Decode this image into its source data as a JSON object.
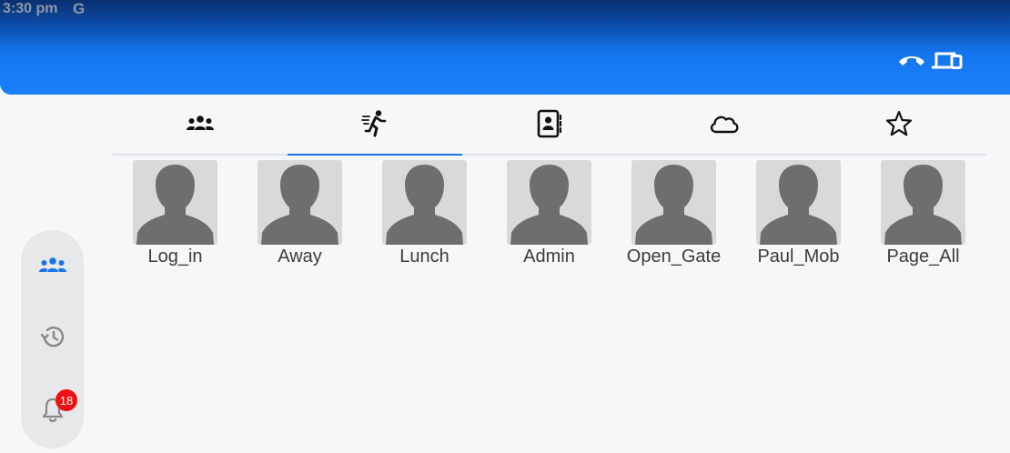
{
  "status_bar": {
    "time": "3:30 pm",
    "g_mark": "G"
  },
  "header": {
    "icons": [
      "call-end-icon",
      "devices-icon"
    ],
    "color": "#1b80fb"
  },
  "tabs": [
    {
      "icon": "group-icon",
      "active": false
    },
    {
      "icon": "running-person-icon",
      "active": true
    },
    {
      "icon": "contacts-book-icon",
      "active": false
    },
    {
      "icon": "cloud-icon",
      "active": false
    },
    {
      "icon": "star-icon",
      "active": false
    }
  ],
  "contacts": [
    {
      "name": "Log_in"
    },
    {
      "name": "Away"
    },
    {
      "name": "Lunch"
    },
    {
      "name": "Admin"
    },
    {
      "name": "Open_Gate"
    },
    {
      "name": "Paul_Mob"
    },
    {
      "name": "Page_All"
    }
  ],
  "sidebar": {
    "items": [
      {
        "icon": "group-icon",
        "active": true
      },
      {
        "icon": "history-icon",
        "active": false
      },
      {
        "icon": "bell-icon",
        "active": false
      }
    ],
    "notification_badge": "18"
  },
  "colors": {
    "accent": "#1a73e8",
    "badge": "#ee1111"
  }
}
